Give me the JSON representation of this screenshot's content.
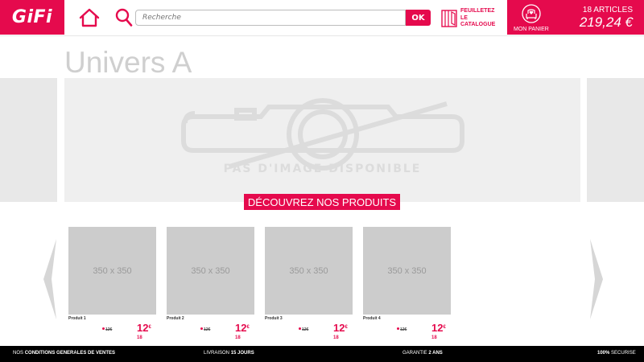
{
  "header": {
    "logo": "GiFi",
    "search_placeholder": "Recherche",
    "ok_label": "OK",
    "catalog_label": "FEUILLETEZ LE CATALOGUE",
    "cart_label": "MON PANIER",
    "cart_count": "18 ARTICLES",
    "cart_total": "219,24 €"
  },
  "page": {
    "title": "Univers A",
    "banner_caption": "PAS D'IMAGE DISPONIBLE",
    "discover_label": "DÉCOUVREZ NOS PRODUITS"
  },
  "products": [
    {
      "image_text": "350 x 350",
      "name": "Produit 1",
      "old_price": "12€",
      "price_main": "12",
      "price_sup": "€",
      "price_cents": "18"
    },
    {
      "image_text": "350 x 350",
      "name": "Produit 2",
      "old_price": "12€",
      "price_main": "12",
      "price_sup": "€",
      "price_cents": "18"
    },
    {
      "image_text": "350 x 350",
      "name": "Produit 3",
      "old_price": "12€",
      "price_main": "12",
      "price_sup": "€",
      "price_cents": "18"
    },
    {
      "image_text": "350 x 350",
      "name": "Produit 4",
      "old_price": "12€",
      "price_main": "12",
      "price_sup": "€",
      "price_cents": "18"
    }
  ],
  "footer": {
    "cgv_prefix": "NOS",
    "cgv_bold": "CONDITIONS GENERALES DE VENTES",
    "delivery_prefix": "LIVRAISON",
    "delivery_bold": "15 JOURS",
    "warranty_prefix": "GARANTIE",
    "warranty_bold": "2 ANS",
    "secure_bold": "100%",
    "secure_suffix": "SECURISE"
  },
  "colors": {
    "brand": "#e50a4d",
    "placeholder_gray": "#cccccc",
    "footer_bg": "#000000"
  },
  "icons": {
    "home": "home-icon",
    "search": "search-icon",
    "catalog": "catalog-icon",
    "cart": "armchair-heart-icon",
    "prev": "chevron-left-icon",
    "next": "chevron-right-icon",
    "banner": "camera-icon"
  }
}
